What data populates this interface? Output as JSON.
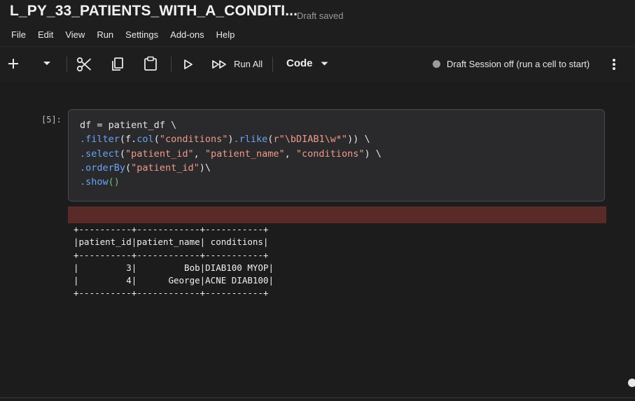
{
  "notebook": {
    "title": "L_PY_33_PATIENTS_WITH_A_CONDITI...",
    "save_status": "Draft saved"
  },
  "menu": [
    "File",
    "Edit",
    "View",
    "Run",
    "Settings",
    "Add-ons",
    "Help"
  ],
  "toolbar": {
    "run_all_label": "Run All",
    "cell_type": "Code",
    "session_status": "Draft Session off (run a cell to start)",
    "icons": [
      "add-icon",
      "chevron-down-icon",
      "scissors-icon",
      "copy-icon",
      "paste-icon",
      "play-icon",
      "run-all-icon",
      "chevron-down-icon",
      "more-vertical-icon"
    ]
  },
  "cell": {
    "prompt": "[5]:",
    "code_lines": [
      "df = patient_df \\",
      ".filter(f.col(\"conditions\").rlike(r\"\\bDIAB1\\w*\")) \\",
      ".select(\"patient_id\", \"patient_name\", \"conditions\") \\",
      ".orderBy(\"patient_id\")\\",
      ".show()"
    ],
    "output_lines": [
      "+----------+------------+-----------+",
      "|patient_id|patient_name| conditions|",
      "+----------+------------+-----------+",
      "|         3|         Bob|DIAB100 MYOP|",
      "|         4|      George|ACNE DIAB100|",
      "+----------+------------+-----------+"
    ]
  },
  "colors": {
    "background": "#1c1c1d",
    "stderr_bar": "#5a2a28",
    "code_method": "#6ba3f5",
    "code_string": "#f09a8a"
  }
}
